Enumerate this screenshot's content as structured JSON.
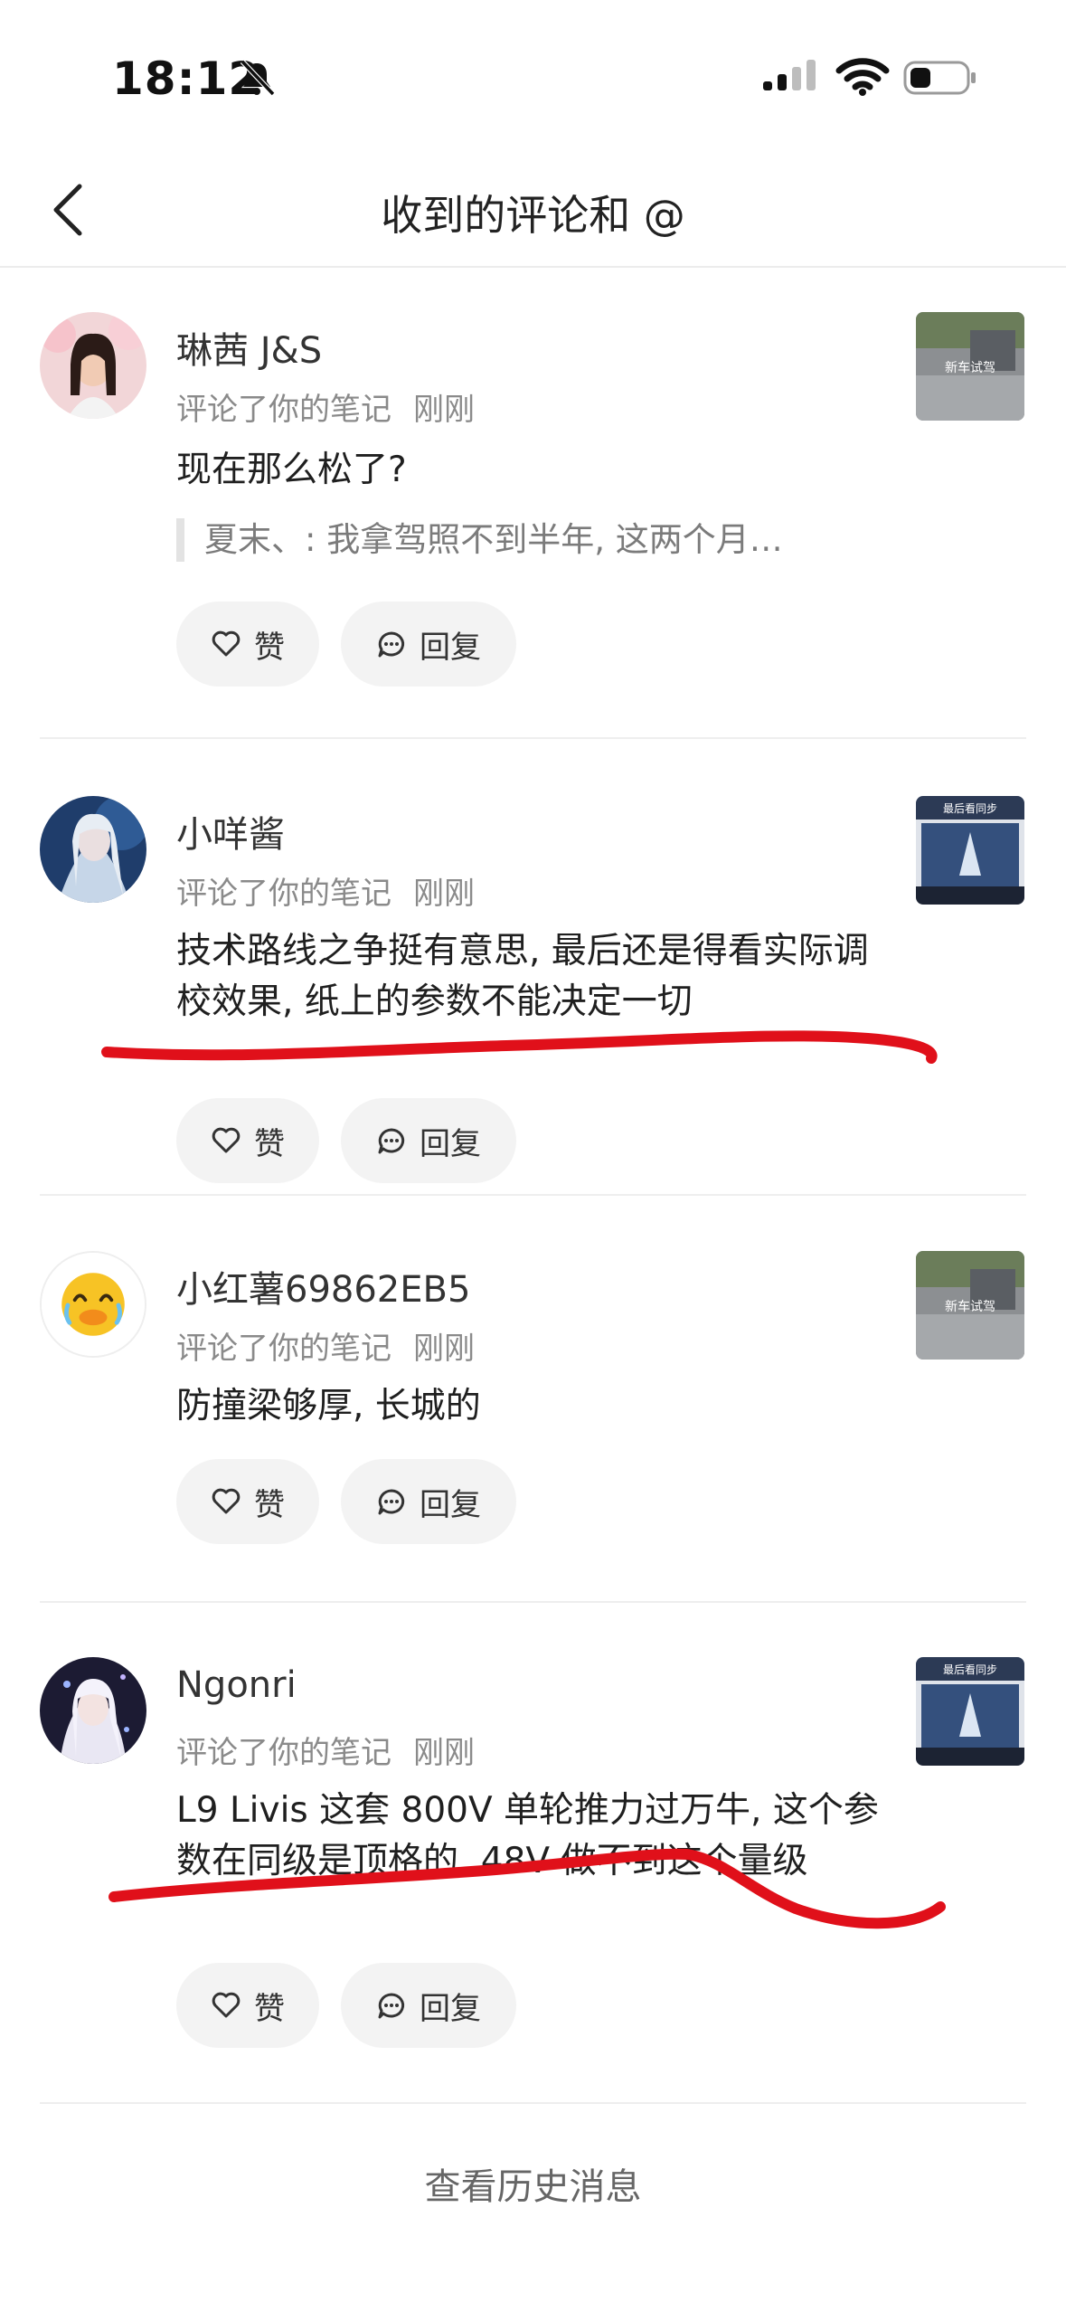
{
  "status_bar": {
    "time": "18:12"
  },
  "nav": {
    "title": "收到的评论和 @"
  },
  "items": [
    {
      "username": "琳茜 J&S",
      "action": "评论了你的笔记",
      "time": "刚刚",
      "comment": "现在那么松了?",
      "quote": "夏末、: 我拿驾照不到半年, 这两个月…",
      "like_label": "赞",
      "reply_label": "回复",
      "thumb_caption": "新车试驾"
    },
    {
      "username": "小咩酱",
      "action": "评论了你的笔记",
      "time": "刚刚",
      "comment": "技术路线之争挺有意思, 最后还是得看实际调校效果, 纸上的参数不能决定一切",
      "like_label": "赞",
      "reply_label": "回复",
      "thumb_caption": "最后看同步"
    },
    {
      "username": "小红薯69862EB5",
      "action": "评论了你的笔记",
      "time": "刚刚",
      "comment": "防撞梁够厚, 长城的",
      "like_label": "赞",
      "reply_label": "回复",
      "thumb_caption": "新车试驾"
    },
    {
      "username": "Ngonri",
      "action": "评论了你的笔记",
      "time": "刚刚",
      "comment": "L9 Livis 这套 800V 单轮推力过万牛, 这个参数在同级是顶格的, 48V 做不到这个量级",
      "like_label": "赞",
      "reply_label": "回复",
      "thumb_caption": "最后看同步"
    }
  ],
  "footer": {
    "history_label": "查看历史消息"
  },
  "colors": {
    "annotation": "#e0101a",
    "pill_bg": "#f3f3f3"
  }
}
